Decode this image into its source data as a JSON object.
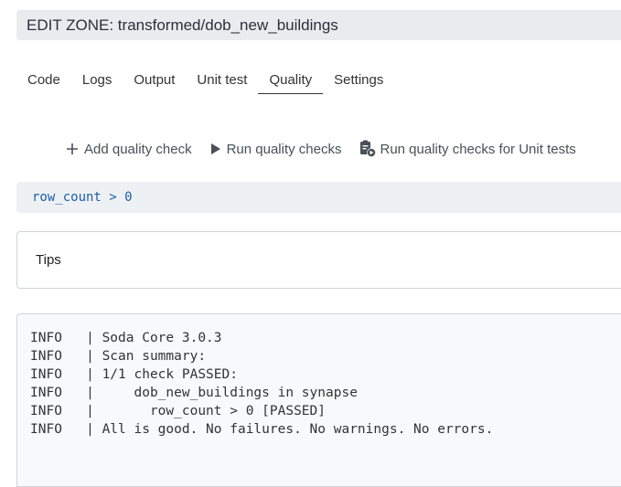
{
  "header": {
    "title": "EDIT ZONE: transformed/dob_new_buildings"
  },
  "tabs": [
    {
      "label": "Code"
    },
    {
      "label": "Logs"
    },
    {
      "label": "Output"
    },
    {
      "label": "Unit test"
    },
    {
      "label": "Quality",
      "active": true
    },
    {
      "label": "Settings"
    }
  ],
  "toolbar": {
    "add_label": "Add quality check",
    "run_label": "Run quality checks",
    "run_unit_label": "Run quality checks for Unit tests",
    "add_icon": "plus-icon",
    "run_icon": "play-icon",
    "run_unit_icon": "clipboard-play-icon"
  },
  "query": {
    "text": "row_count > 0"
  },
  "tips": {
    "label": "Tips"
  },
  "log": {
    "lines": [
      "INFO   | Soda Core 3.0.3",
      "INFO   | Scan summary:",
      "INFO   | 1/1 check PASSED:",
      "INFO   |     dob_new_buildings in synapse",
      "INFO   |       row_count > 0 [PASSED]",
      "INFO   | All is good. No failures. No warnings. No errors."
    ]
  },
  "colors": {
    "header_bg": "#e9ecef",
    "query_text": "#1a5ea8",
    "log_bg": "#f8f9fa"
  }
}
